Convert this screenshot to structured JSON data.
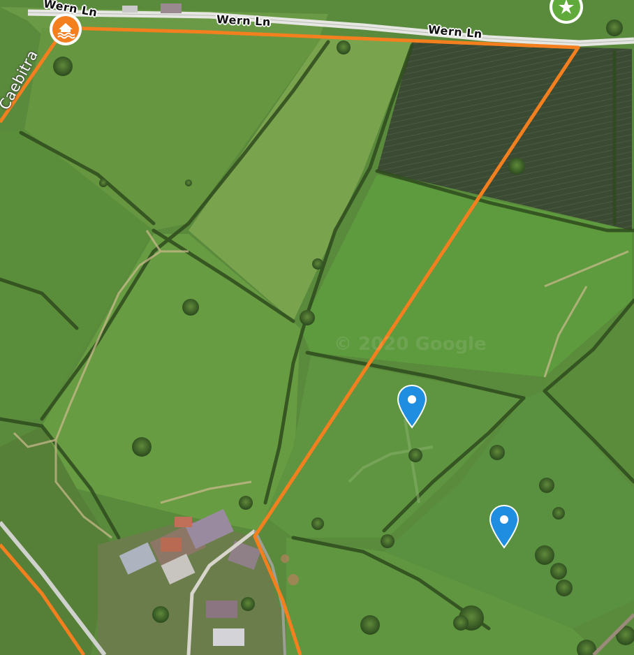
{
  "map": {
    "type": "satellite",
    "attribution": "© 2020 Google",
    "road_labels": {
      "top_left": "Wern Ln",
      "top_center": "Wern Ln",
      "top_right": "Wern Ln",
      "left": "Caebitra"
    },
    "colors": {
      "boundary": "#f47f1f",
      "pin": "#1f8de0",
      "house_marker": "#f47f1f",
      "star_marker": "#5faa3a"
    },
    "markers": [
      {
        "icon": "location-pin-icon"
      },
      {
        "icon": "location-pin-icon"
      },
      {
        "icon": "house-water-icon"
      },
      {
        "icon": "star-icon"
      }
    ]
  }
}
